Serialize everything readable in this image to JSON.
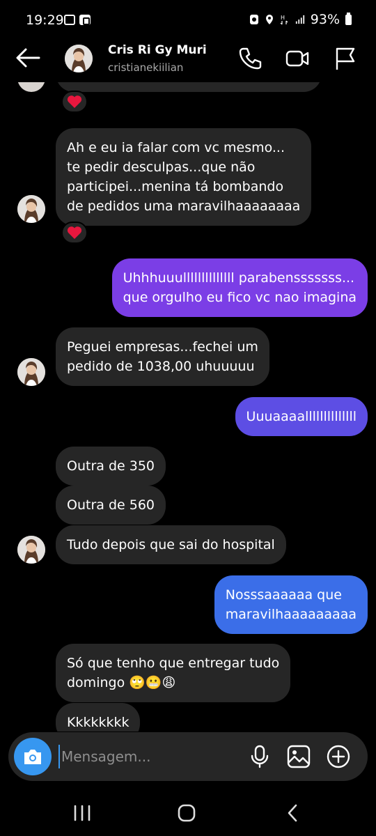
{
  "status_bar": {
    "time": "19:29",
    "battery": "93%"
  },
  "header": {
    "name": "Cris Ri Gy Muri",
    "username": "cristianekiilian"
  },
  "messages": [
    {
      "side": "in",
      "text": "Ah e eu ia falar com vc mesmo...\nte pedir desculpas...que não\nparticipei...menina tá bombando\nde pedidos uma maravilhaaaaaaaa",
      "reaction": "❤️"
    },
    {
      "side": "out",
      "text": "Uhhhuuullllllllllllll parabensssssss...\nque orgulho eu fico vc nao imagina"
    },
    {
      "side": "in",
      "text": "Peguei empresas...fechei um\npedido de 1038,00 uhuuuuu"
    },
    {
      "side": "out",
      "text": "Uuuaaaallllllllllllll"
    },
    {
      "side": "in",
      "text": "Outra de 350"
    },
    {
      "side": "in",
      "text": "Outra de 560"
    },
    {
      "side": "in",
      "text": "Tudo depois que sai do hospital"
    },
    {
      "side": "out",
      "text": "Nosssaaaaaa que\nmaravilhaaaaaaaaa"
    },
    {
      "side": "in",
      "text": "Só que tenho que entregar tudo\ndomingo 🙄😬😩"
    },
    {
      "side": "in",
      "text": "Kkkkkkkk"
    }
  ],
  "top_reaction": "❤️",
  "composer": {
    "placeholder": "Mensagem..."
  },
  "icons": {
    "back": "arrow-left-icon",
    "call": "phone-icon",
    "video": "video-camera-icon",
    "flag": "flag-icon",
    "camera": "camera-icon",
    "mic": "microphone-icon",
    "gallery": "image-icon",
    "plus": "plus-circle-icon"
  },
  "colors": {
    "incoming_bubble": "#262626",
    "outgoing_purple": "#7b3ee6",
    "outgoing_blue": "#3b6ee8",
    "camera_button": "#3797f0",
    "username": "#a8a8a8"
  }
}
